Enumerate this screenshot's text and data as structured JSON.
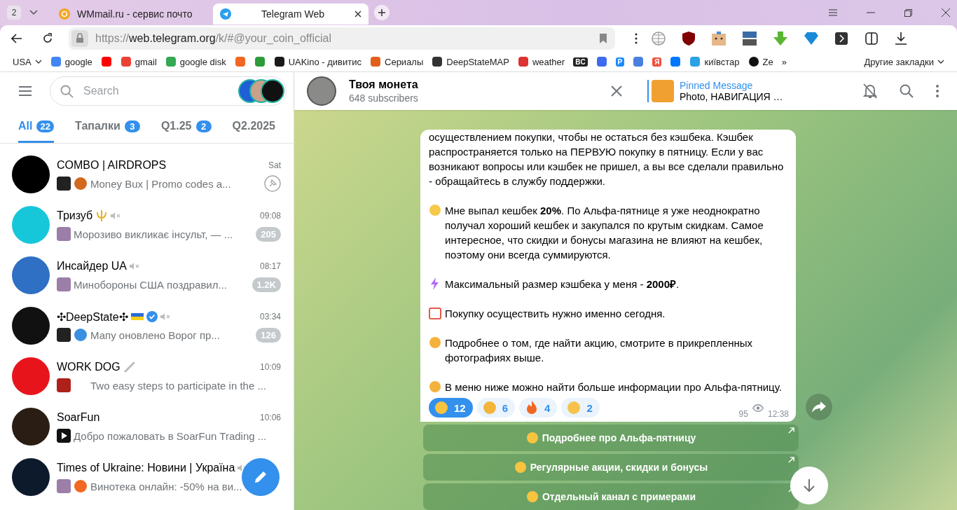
{
  "browser": {
    "tab_count": "2",
    "tabs": [
      {
        "title": "WMmail.ru - сервис почто",
        "selected": false
      },
      {
        "title": "Telegram Web",
        "selected": true
      }
    ],
    "url": {
      "scheme": "https://",
      "host": "web.telegram.org",
      "path": "/k/#@your_coin_official"
    },
    "bookmarks": [
      "USA",
      "google",
      "gmail",
      "google disk",
      "UAKino - дивитис",
      "Сериалы",
      "DeepStateMAP",
      "weather",
      "BC",
      "P",
      "Я",
      "київстар",
      "Ze"
    ],
    "more_bookmarks": "»",
    "other_bookmarks": "Другие закладки"
  },
  "sidebar": {
    "search": {
      "placeholder": "Search"
    },
    "folders": [
      {
        "label": "All",
        "count": "22",
        "selected": true
      },
      {
        "label": "Тапалки",
        "count": "3",
        "selected": false
      },
      {
        "label": "Q1.25",
        "count": "2",
        "selected": false
      },
      {
        "label": "Q2.2025",
        "selected": false
      }
    ],
    "chats": [
      {
        "name": "COMBO | AIRDROPS",
        "time": "Sat",
        "preview": "Money Bux | Promo codes  a...",
        "color": "#000000",
        "muted": false,
        "verified": false,
        "pinned": true
      },
      {
        "name": "Тризуб",
        "time": "09:08",
        "preview": "Морозиво викликає інсульт, — ...",
        "color": "#16c7d9",
        "muted": true,
        "verified": false,
        "pinned": false,
        "badge": "205"
      },
      {
        "name": "Инсайдер UA",
        "time": "08:17",
        "preview": "Минобороны США поздравил...",
        "color": "#2f6fc4",
        "muted": true,
        "verified": false,
        "pinned": false,
        "badge": "1.2K"
      },
      {
        "name": "✣DeepState✣",
        "time": "03:34",
        "preview": "Мапу оновлено  Ворог пр...",
        "color": "#111111",
        "muted": true,
        "verified": true,
        "pinned": false,
        "badge": "126"
      },
      {
        "name": "WORK DOG",
        "time": "10:09",
        "preview": "Two easy steps to participate in the ...",
        "color": "#e8141b",
        "muted": false,
        "verified": false,
        "pinned": false
      },
      {
        "name": "SoarFun",
        "time": "10:06",
        "preview": "Добро пожаловать в SoarFun Trading ...",
        "color": "#2a1e14",
        "muted": false,
        "verified": false,
        "pinned": false
      },
      {
        "name": "Times of Ukraine: Новини | Україна",
        "preview": "Винотека онлайн: -50% на ви...",
        "color": "#0d1a2b",
        "muted": true,
        "verified": false,
        "pinned": false
      }
    ]
  },
  "chat": {
    "title": "Твоя монета",
    "subtitle": "648 subscribers",
    "pinned": {
      "title": "Pinned Message",
      "preview": "Photo, НАВИГАЦИЯ …"
    },
    "message": {
      "paragraphs": [
        {
          "text": "осуществлением покупки, чтобы не остаться без кэшбека. Кэшбек распространяется только на ПЕРВУЮ покупку в пятницу. Если у вас возникают вопросы или кэшбек не пришел, а вы все сделали правильно - обращайтесь в службу поддержки."
        },
        {
          "text": "Мне выпал кешбек **20%**. По Альфа-пятнице я уже неоднократно получал хороший кешбек и закупался по крутым скидкам. Самое интересное, что скидки и бонусы магазина не влияют на кешбек, поэтому они всегда суммируются."
        },
        {
          "text": "Максимальный размер кэшбека у меня - **2000₽**."
        },
        {
          "text": "Покупку осуществить нужно именно сегодня."
        },
        {
          "text": "Подробнее о том, где найти акцию, смотрите в прикрепленных фотографиях выше."
        },
        {
          "text": "В меню ниже можно найти больше информации про Альфа-пятницу."
        }
      ],
      "reactions": [
        {
          "count": "12",
          "selected": true
        },
        {
          "count": "6",
          "selected": false
        },
        {
          "count": "4",
          "selected": false
        },
        {
          "count": "2",
          "selected": false
        }
      ],
      "views": "95",
      "time": "12:38"
    },
    "buttons": [
      {
        "label": "Подробнее про Альфа-пятницу"
      },
      {
        "label": "Регулярные акции, скидки и бонусы"
      },
      {
        "label": "Отдельный канал с примерами"
      }
    ]
  }
}
